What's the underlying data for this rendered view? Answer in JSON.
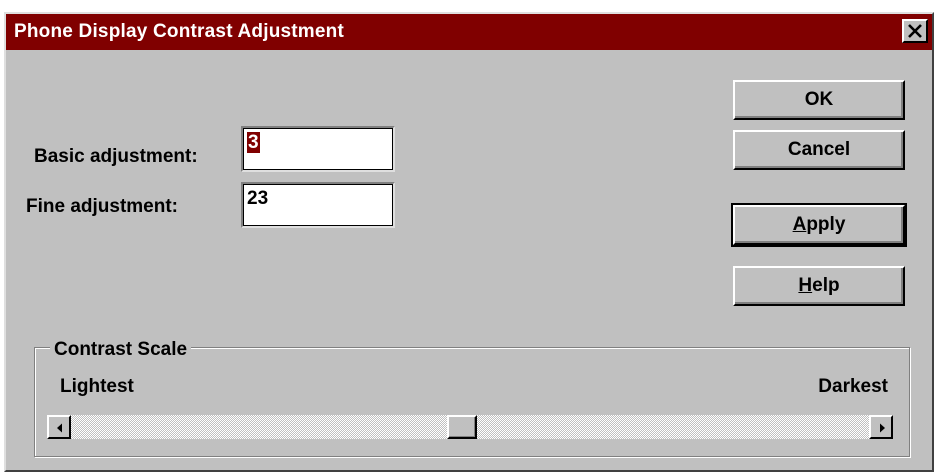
{
  "window": {
    "title": "Phone Display Contrast Adjustment"
  },
  "fields": {
    "basic": {
      "label": "Basic adjustment:",
      "value": "3"
    },
    "fine": {
      "label": "Fine adjustment:",
      "value": "23"
    }
  },
  "buttons": {
    "ok": {
      "label": "OK"
    },
    "cancel": {
      "label": "Cancel"
    },
    "apply": {
      "mnemonic": "A",
      "rest": "pply"
    },
    "help": {
      "mnemonic": "H",
      "rest": "elp"
    }
  },
  "contrast_scale": {
    "title": "Contrast Scale",
    "min_label": "Lightest",
    "max_label": "Darkest",
    "position_fraction": 0.49
  },
  "colors": {
    "titlebar": "#800000",
    "face": "#c0c0c0",
    "selection": "#800000"
  },
  "icons": {
    "close": "close-x-icon",
    "scroll_left": "left-arrow-icon",
    "scroll_right": "right-arrow-icon"
  }
}
